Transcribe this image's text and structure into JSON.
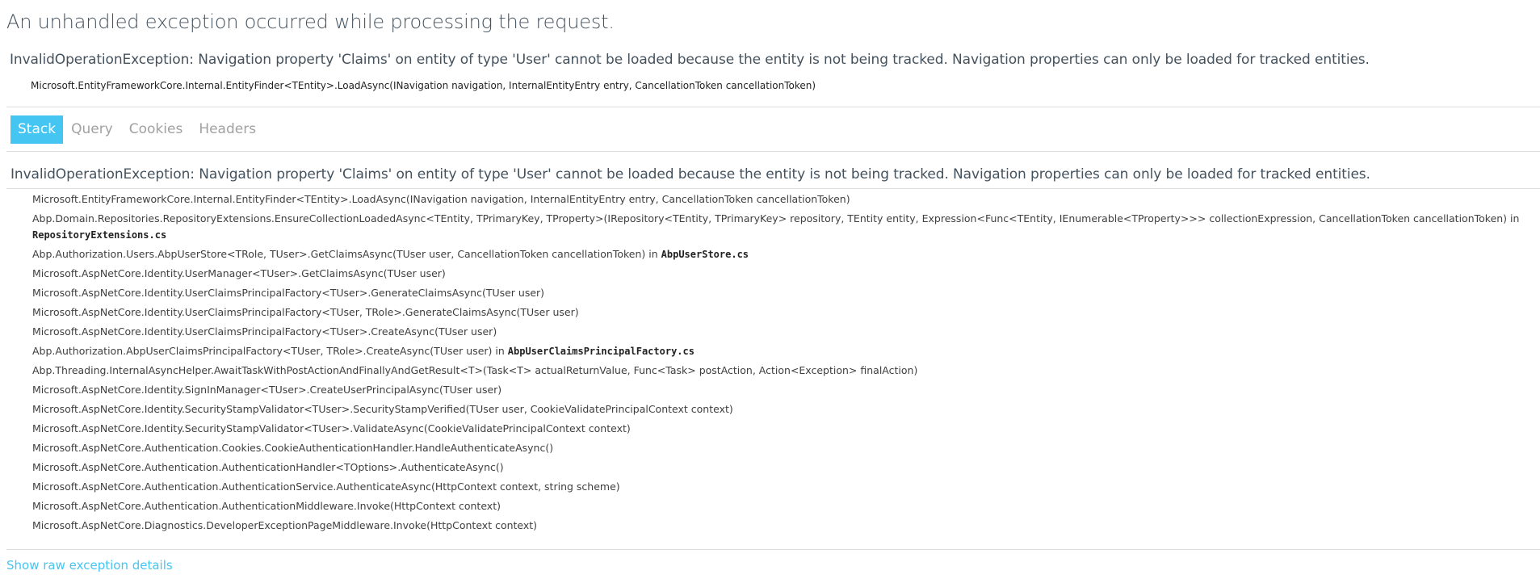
{
  "title": "An unhandled exception occurred while processing the request.",
  "error": {
    "message": "InvalidOperationException: Navigation property 'Claims' on entity of type 'User' cannot be loaded because the entity is not being tracked. Navigation properties can only be loaded for tracked entities.",
    "location": "Microsoft.EntityFrameworkCore.Internal.EntityFinder<TEntity>.LoadAsync(INavigation navigation, InternalEntityEntry entry, CancellationToken cancellationToken)"
  },
  "tabs": [
    "Stack",
    "Query",
    "Cookies",
    "Headers"
  ],
  "active_tab": "Stack",
  "stack": {
    "heading": "InvalidOperationException: Navigation property 'Claims' on entity of type 'User' cannot be loaded because the entity is not being tracked. Navigation properties can only be loaded for tracked entities.",
    "frames": [
      {
        "method": "Microsoft.EntityFrameworkCore.Internal.EntityFinder<TEntity>.LoadAsync(INavigation navigation, InternalEntityEntry entry, CancellationToken cancellationToken)",
        "file": ""
      },
      {
        "method": "Abp.Domain.Repositories.RepositoryExtensions.EnsureCollectionLoadedAsync<TEntity, TPrimaryKey, TProperty>(IRepository<TEntity, TPrimaryKey> repository, TEntity entity, Expression<Func<TEntity, IEnumerable<TProperty>>> collectionExpression, CancellationToken cancellationToken) in",
        "file": "RepositoryExtensions.cs"
      },
      {
        "method": "Abp.Authorization.Users.AbpUserStore<TRole, TUser>.GetClaimsAsync(TUser user, CancellationToken cancellationToken) in",
        "file": "AbpUserStore.cs"
      },
      {
        "method": "Microsoft.AspNetCore.Identity.UserManager<TUser>.GetClaimsAsync(TUser user)",
        "file": ""
      },
      {
        "method": "Microsoft.AspNetCore.Identity.UserClaimsPrincipalFactory<TUser>.GenerateClaimsAsync(TUser user)",
        "file": ""
      },
      {
        "method": "Microsoft.AspNetCore.Identity.UserClaimsPrincipalFactory<TUser, TRole>.GenerateClaimsAsync(TUser user)",
        "file": ""
      },
      {
        "method": "Microsoft.AspNetCore.Identity.UserClaimsPrincipalFactory<TUser>.CreateAsync(TUser user)",
        "file": ""
      },
      {
        "method": "Abp.Authorization.AbpUserClaimsPrincipalFactory<TUser, TRole>.CreateAsync(TUser user) in",
        "file": "AbpUserClaimsPrincipalFactory.cs"
      },
      {
        "method": "Abp.Threading.InternalAsyncHelper.AwaitTaskWithPostActionAndFinallyAndGetResult<T>(Task<T> actualReturnValue, Func<Task> postAction, Action<Exception> finalAction)",
        "file": ""
      },
      {
        "method": "Microsoft.AspNetCore.Identity.SignInManager<TUser>.CreateUserPrincipalAsync(TUser user)",
        "file": ""
      },
      {
        "method": "Microsoft.AspNetCore.Identity.SecurityStampValidator<TUser>.SecurityStampVerified(TUser user, CookieValidatePrincipalContext context)",
        "file": ""
      },
      {
        "method": "Microsoft.AspNetCore.Identity.SecurityStampValidator<TUser>.ValidateAsync(CookieValidatePrincipalContext context)",
        "file": ""
      },
      {
        "method": "Microsoft.AspNetCore.Authentication.Cookies.CookieAuthenticationHandler.HandleAuthenticateAsync()",
        "file": ""
      },
      {
        "method": "Microsoft.AspNetCore.Authentication.AuthenticationHandler<TOptions>.AuthenticateAsync()",
        "file": ""
      },
      {
        "method": "Microsoft.AspNetCore.Authentication.AuthenticationService.AuthenticateAsync(HttpContext context, string scheme)",
        "file": ""
      },
      {
        "method": "Microsoft.AspNetCore.Authentication.AuthenticationMiddleware.Invoke(HttpContext context)",
        "file": ""
      },
      {
        "method": "Microsoft.AspNetCore.Diagnostics.DeveloperExceptionPageMiddleware.Invoke(HttpContext context)",
        "file": ""
      }
    ]
  },
  "raw_link": "Show raw exception details",
  "colors": {
    "accent": "#44c5f2",
    "heading": "#44525e",
    "inactive_tab": "#a1a1a1",
    "divider": "#dddddd"
  }
}
